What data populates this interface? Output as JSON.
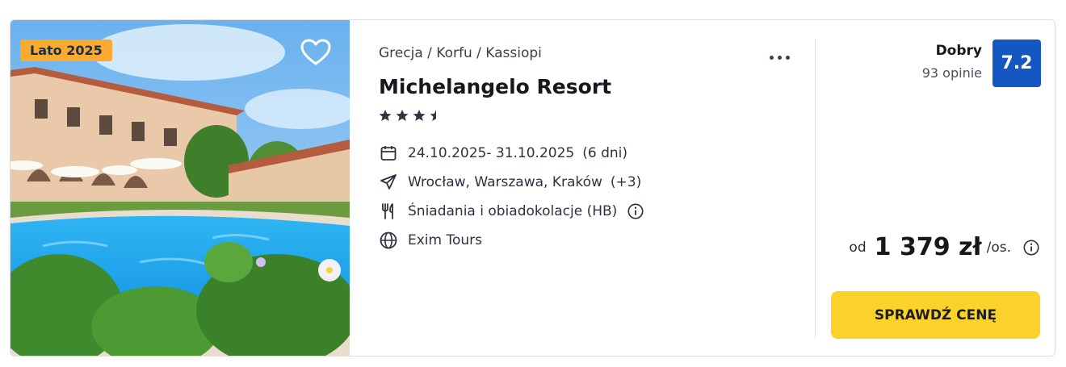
{
  "photo": {
    "badge": "Lato 2025"
  },
  "offer": {
    "breadcrumb": "Grecja / Korfu / Kassiopi",
    "hotel_name": "Michelangelo Resort",
    "stars": 3.5,
    "dates": "24.10.2025- 31.10.2025",
    "duration": "(6 dni)",
    "departure": "Wrocław, Warszawa, Kraków",
    "departure_more": "(+3)",
    "board": "Śniadania i obiadokolacje (HB)",
    "operator": "Exim Tours"
  },
  "rating": {
    "label": "Dobry",
    "count": "93 opinie",
    "score": "7.2"
  },
  "price": {
    "from": "od",
    "value": "1 379 zł",
    "unit": "/os."
  },
  "cta": {
    "label": "SPRAWDŹ CENĘ"
  },
  "colors": {
    "accent": "#fbd12c",
    "rating": "#1557c2",
    "badge": "#f8ab2f"
  },
  "icons": [
    "heart-icon",
    "more-icon",
    "star-icon",
    "calendar-icon",
    "plane-icon",
    "restaurant-icon",
    "globe-icon",
    "info-icon"
  ]
}
